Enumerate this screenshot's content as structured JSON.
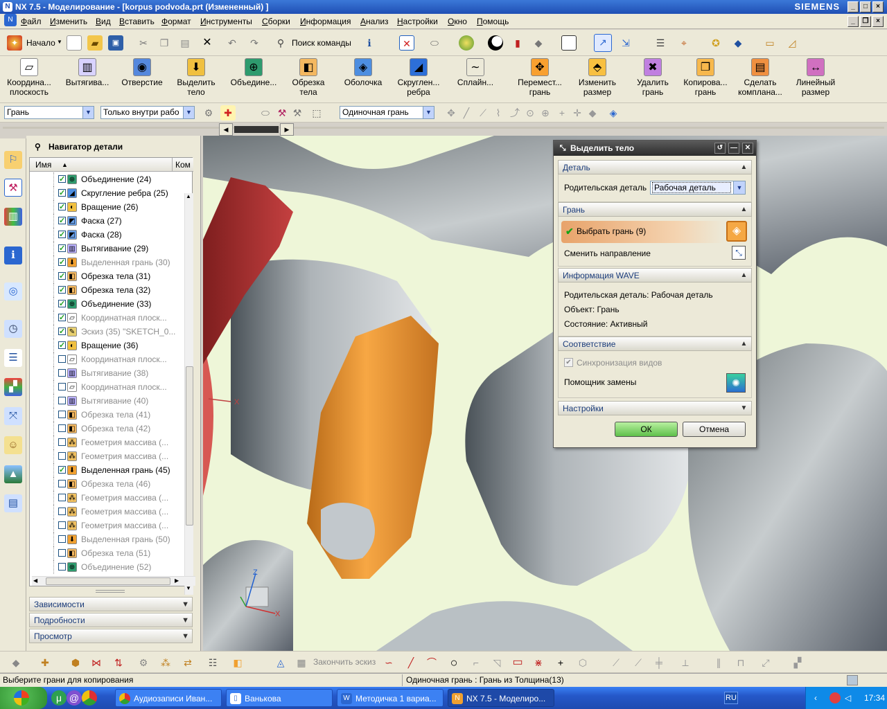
{
  "window": {
    "title": "NX 7.5 - Моделирование - [korpus podvoda.prt (Измененный) ]",
    "brand": "SIEMENS"
  },
  "menu": [
    "Файл",
    "Изменить",
    "Вид",
    "Вставить",
    "Формат",
    "Инструменты",
    "Сборки",
    "Информация",
    "Анализ",
    "Настройки",
    "Окно",
    "Помощь"
  ],
  "toolbar1": {
    "start_label": "Начало",
    "search_label": "Поиск команды"
  },
  "toolbar2": [
    {
      "label1": "Координа...",
      "label2": "плоскость",
      "icon": "datum-plane-icon",
      "color": "#ffffff",
      "sym": "▱"
    },
    {
      "label1": "Вытягива...",
      "label2": "",
      "icon": "extrude-icon",
      "color": "#d9d3ff",
      "sym": "▥"
    },
    {
      "label1": "Отверстие",
      "label2": "",
      "icon": "hole-icon",
      "color": "#5588dd",
      "sym": "◉"
    },
    {
      "label1": "Выделить",
      "label2": "тело",
      "icon": "extract-body-icon",
      "color": "#f0c040",
      "sym": "⬇"
    },
    {
      "label1": "Объедине...",
      "label2": "",
      "icon": "unite-icon",
      "color": "#2e9b6e",
      "sym": "⊕"
    },
    {
      "label1": "Обрезка",
      "label2": "тела",
      "icon": "trim-body-icon",
      "color": "#f4b860",
      "sym": "◧"
    },
    {
      "label1": "Оболочка",
      "label2": "",
      "icon": "shell-icon",
      "color": "#4d8ee0",
      "sym": "◈"
    },
    {
      "label1": "Скруглен...",
      "label2": "ребра",
      "icon": "edge-blend-icon",
      "color": "#2d6fd8",
      "sym": "◢"
    },
    {
      "label1": "Сплайн...",
      "label2": "",
      "icon": "spline-icon",
      "color": "#ece9d8",
      "sym": "∼"
    },
    {
      "label1": "Перемест...",
      "label2": "грань",
      "icon": "move-face-icon",
      "color": "#f8a030",
      "sym": "✥"
    },
    {
      "label1": "Изменить",
      "label2": "размер",
      "icon": "resize-face-icon",
      "color": "#f8c040",
      "sym": "⬘"
    },
    {
      "label1": "Удалить",
      "label2": "грань",
      "icon": "delete-face-icon",
      "color": "#c080e0",
      "sym": "✖"
    },
    {
      "label1": "Копирова...",
      "label2": "грань",
      "icon": "copy-face-icon",
      "color": "#f7b84c",
      "sym": "❐"
    },
    {
      "label1": "Сделать",
      "label2": "компланa...",
      "icon": "make-coplanar-icon",
      "color": "#f09040",
      "sym": "▤"
    },
    {
      "label1": "Линейный",
      "label2": "размер",
      "icon": "linear-dimension-icon",
      "color": "#d070c0",
      "sym": "↔"
    }
  ],
  "selection_bar": {
    "filter": "Грань",
    "scope": "Только внутри рабо",
    "rule": "Одиночная грань"
  },
  "navigator": {
    "title": "Навигатор детали",
    "col_name": "Имя",
    "col_comment": "Ком",
    "rows": [
      {
        "label": "Объединение (24)",
        "checked": true,
        "dim": false,
        "icon": "unite-icon",
        "color": "#2e9b6e",
        "sym": "⊕"
      },
      {
        "label": "Скругление ребра (25)",
        "checked": true,
        "dim": false,
        "icon": "edge-blend-icon",
        "color": "#4d8ee0",
        "sym": "◢"
      },
      {
        "label": "Вращение (26)",
        "checked": true,
        "dim": false,
        "icon": "revolve-icon",
        "color": "#f0c040",
        "sym": "◐"
      },
      {
        "label": "Фаска (27)",
        "checked": true,
        "dim": false,
        "icon": "chamfer-icon",
        "color": "#6aa0e8",
        "sym": "◩"
      },
      {
        "label": "Фаска (28)",
        "checked": true,
        "dim": false,
        "icon": "chamfer-icon",
        "color": "#6aa0e8",
        "sym": "◩"
      },
      {
        "label": "Вытягивание (29)",
        "checked": true,
        "dim": false,
        "icon": "extrude-icon",
        "color": "#b9b0ff",
        "sym": "▥"
      },
      {
        "label": "Выделенная грань (30)",
        "checked": true,
        "dim": true,
        "icon": "extracted-face-icon",
        "color": "#f0a030",
        "sym": "⬇"
      },
      {
        "label": "Обрезка тела (31)",
        "checked": true,
        "dim": false,
        "icon": "trim-body-icon",
        "color": "#f4b860",
        "sym": "◧"
      },
      {
        "label": "Обрезка тела (32)",
        "checked": true,
        "dim": false,
        "icon": "trim-body-icon",
        "color": "#f4b860",
        "sym": "◧"
      },
      {
        "label": "Объединение (33)",
        "checked": true,
        "dim": false,
        "icon": "unite-icon",
        "color": "#2e9b6e",
        "sym": "⊕"
      },
      {
        "label": "Координатная плоск...",
        "checked": true,
        "dim": true,
        "icon": "datum-plane-icon",
        "color": "#ffffff",
        "sym": "▱"
      },
      {
        "label": "Эскиз (35) \"SKETCH_0...",
        "checked": true,
        "dim": true,
        "icon": "sketch-icon",
        "color": "#e8d070",
        "sym": "✎"
      },
      {
        "label": "Вращение (36)",
        "checked": true,
        "dim": false,
        "icon": "revolve-icon",
        "color": "#f0c040",
        "sym": "◐"
      },
      {
        "label": "Координатная плоск...",
        "checked": false,
        "dim": true,
        "icon": "datum-plane-icon",
        "color": "#ffffff",
        "sym": "▱"
      },
      {
        "label": "Вытягивание (38)",
        "checked": false,
        "dim": true,
        "icon": "extrude-icon",
        "color": "#b9b0ff",
        "sym": "▥"
      },
      {
        "label": "Координатная плоск...",
        "checked": false,
        "dim": true,
        "icon": "datum-plane-icon",
        "color": "#ffffff",
        "sym": "▱"
      },
      {
        "label": "Вытягивание (40)",
        "checked": false,
        "dim": true,
        "icon": "extrude-icon",
        "color": "#b9b0ff",
        "sym": "▥"
      },
      {
        "label": "Обрезка тела (41)",
        "checked": false,
        "dim": true,
        "icon": "trim-body-icon",
        "color": "#f4b860",
        "sym": "◧"
      },
      {
        "label": "Обрезка тела (42)",
        "checked": false,
        "dim": true,
        "icon": "trim-body-icon",
        "color": "#f4b860",
        "sym": "◧"
      },
      {
        "label": "Геометрия массива (...",
        "checked": false,
        "dim": true,
        "icon": "pattern-geometry-icon",
        "color": "#f0c060",
        "sym": "⁂"
      },
      {
        "label": "Геометрия массива (...",
        "checked": false,
        "dim": true,
        "icon": "pattern-geometry-icon",
        "color": "#f0c060",
        "sym": "⁂"
      },
      {
        "label": "Выделенная грань (45)",
        "checked": true,
        "dim": false,
        "icon": "extracted-face-icon",
        "color": "#f0a030",
        "sym": "⬇"
      },
      {
        "label": "Обрезка тела (46)",
        "checked": false,
        "dim": true,
        "icon": "trim-body-icon",
        "color": "#f4b860",
        "sym": "◧"
      },
      {
        "label": "Геометрия массива (...",
        "checked": false,
        "dim": true,
        "icon": "pattern-geometry-icon",
        "color": "#f0c060",
        "sym": "⁂"
      },
      {
        "label": "Геометрия массива (...",
        "checked": false,
        "dim": true,
        "icon": "pattern-geometry-icon",
        "color": "#f0c060",
        "sym": "⁂"
      },
      {
        "label": "Геометрия массива (...",
        "checked": false,
        "dim": true,
        "icon": "pattern-geometry-icon",
        "color": "#f0c060",
        "sym": "⁂"
      },
      {
        "label": "Выделенная грань (50)",
        "checked": false,
        "dim": true,
        "icon": "extracted-face-icon",
        "color": "#f0a030",
        "sym": "⬇"
      },
      {
        "label": "Обрезка тела (51)",
        "checked": false,
        "dim": true,
        "icon": "trim-body-icon",
        "color": "#f4b860",
        "sym": "◧"
      },
      {
        "label": "Объединение (52)",
        "checked": false,
        "dim": true,
        "icon": "unite-icon",
        "color": "#2e9b6e",
        "sym": "⊕"
      }
    ],
    "panels": [
      "Зависимости",
      "Подробности",
      "Просмотр"
    ]
  },
  "dialog": {
    "title": "Выделить тело",
    "sections": {
      "part": "Деталь",
      "face": "Грань",
      "wave_info": "Информация WAVE",
      "association": "Соответствие",
      "settings": "Настройки"
    },
    "parent_label": "Родительская деталь",
    "parent_value": "Рабочая деталь",
    "select_face": "Выбрать грань (9)",
    "reverse_direction": "Сменить направление",
    "wave_parent": "Родительская деталь: Рабочая деталь",
    "wave_object": "Объект: Грань",
    "wave_state": "Состояние: Активный",
    "sync_views": "Синхронизация видов",
    "replacement_assistant": "Помощник замены",
    "ok": "ОК",
    "cancel": "Отмена"
  },
  "viewport": {
    "axis_x": "X",
    "axis_y": "Y",
    "axis_z": "Z"
  },
  "sketch_toolbar": {
    "finish_sketch": "Закончить эскиз"
  },
  "status": {
    "prompt": "Выберите грани для копирования",
    "message": "Одиночная грань : Грань из Толщина(13)"
  },
  "taskbar": {
    "tasks": [
      "Аудиозаписи Иван...",
      "Ванькова",
      "Методичка 1 вариа...",
      "NX 7.5 - Моделиро..."
    ],
    "lang": "RU",
    "clock": "17:34"
  }
}
